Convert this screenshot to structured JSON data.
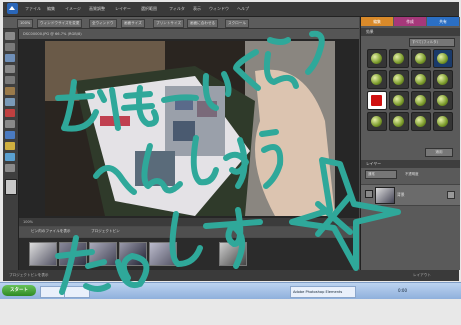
{
  "menubar": {
    "items": [
      "ファイル",
      "編集",
      "イメージ",
      "画質調整",
      "レイヤー",
      "選択範囲",
      "フィルタ",
      "表示",
      "ウィンドウ",
      "ヘルプ"
    ],
    "mode_labels": [
      "編集",
      "作成",
      "共有"
    ]
  },
  "options": {
    "zoom": "100%",
    "buttons": [
      "ウィンドウサイズを変更",
      "全ウィンドウ",
      "画面サイズ",
      "プリントサイズ",
      "画面に合わせる",
      "スクロール"
    ]
  },
  "doc": {
    "title": "DSC00000.JPG @ 66.7% (RGB/8)"
  },
  "status": {
    "zoom": "100%"
  },
  "bin": {
    "label": "プロジェクトビン",
    "select": "ビン内のファイルを表示"
  },
  "panels": {
    "effects_title": "効果",
    "effects_dropdown": "すべて(フィルタ)",
    "apply_button": "適用",
    "layers_title": "レイヤー",
    "layers_blend": "通常",
    "layers_opacity": "不透明度",
    "layer_name": "背景"
  },
  "footer": {
    "left": "プロジェクトビンを表示",
    "right": "レイアウト"
  },
  "taskbar": {
    "start": "スタート",
    "task1": "Adobe Photoshop Elements",
    "tray_time": "0:00"
  },
  "doodles": {
    "line1": "おほーいくらぅ",
    "line2": "へんしゅう",
    "line3": "たのしす",
    "color": "#2fa89a"
  },
  "colors": {
    "accent_edit": "#d98a2a",
    "accent_create": "#a6387a",
    "accent_share": "#2b6fc4"
  }
}
